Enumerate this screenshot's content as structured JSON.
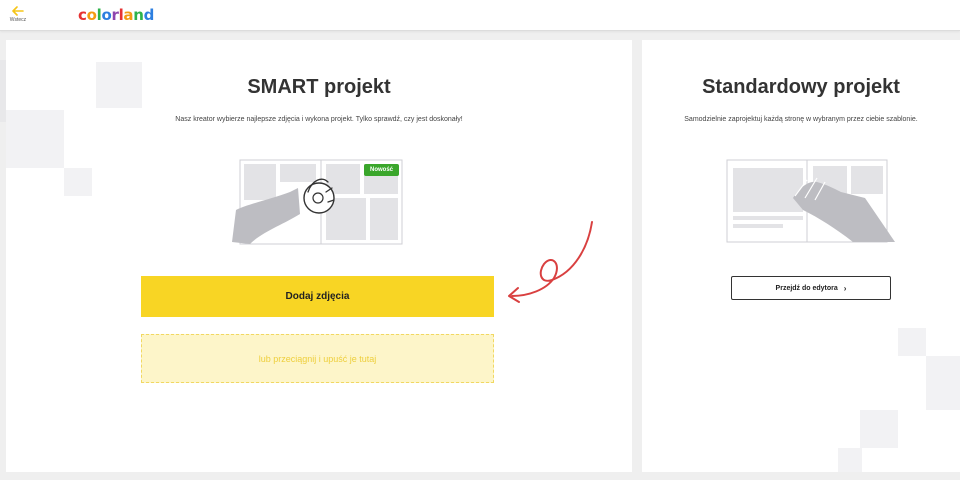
{
  "header": {
    "back_label": "Wstecz",
    "logo_text": "colorland",
    "logo_colors": [
      "#e63232",
      "#f39c12",
      "#2db34a",
      "#2d7fe0",
      "#8e44ad",
      "#e63232",
      "#f39c12",
      "#2db34a",
      "#2d7fe0"
    ]
  },
  "smart": {
    "title": "SMART projekt",
    "subtitle": "Nasz kreator wybierze najlepsze zdjęcia i wykona projekt. Tylko sprawdź, czy jest doskonały!",
    "badge": "Nowość",
    "add_button": "Dodaj zdjęcia",
    "drop_text": "lub przeciągnij i upuść je tutaj"
  },
  "standard": {
    "title": "Standardowy projekt",
    "subtitle": "Samodzielnie zaprojektuj każdą stronę w wybranym przez ciebie szablonie.",
    "editor_button": "Przejdź do edytora"
  },
  "colors": {
    "accent_yellow": "#f8d524",
    "badge_green": "#3aa62b",
    "arrow_red": "#d94040"
  }
}
